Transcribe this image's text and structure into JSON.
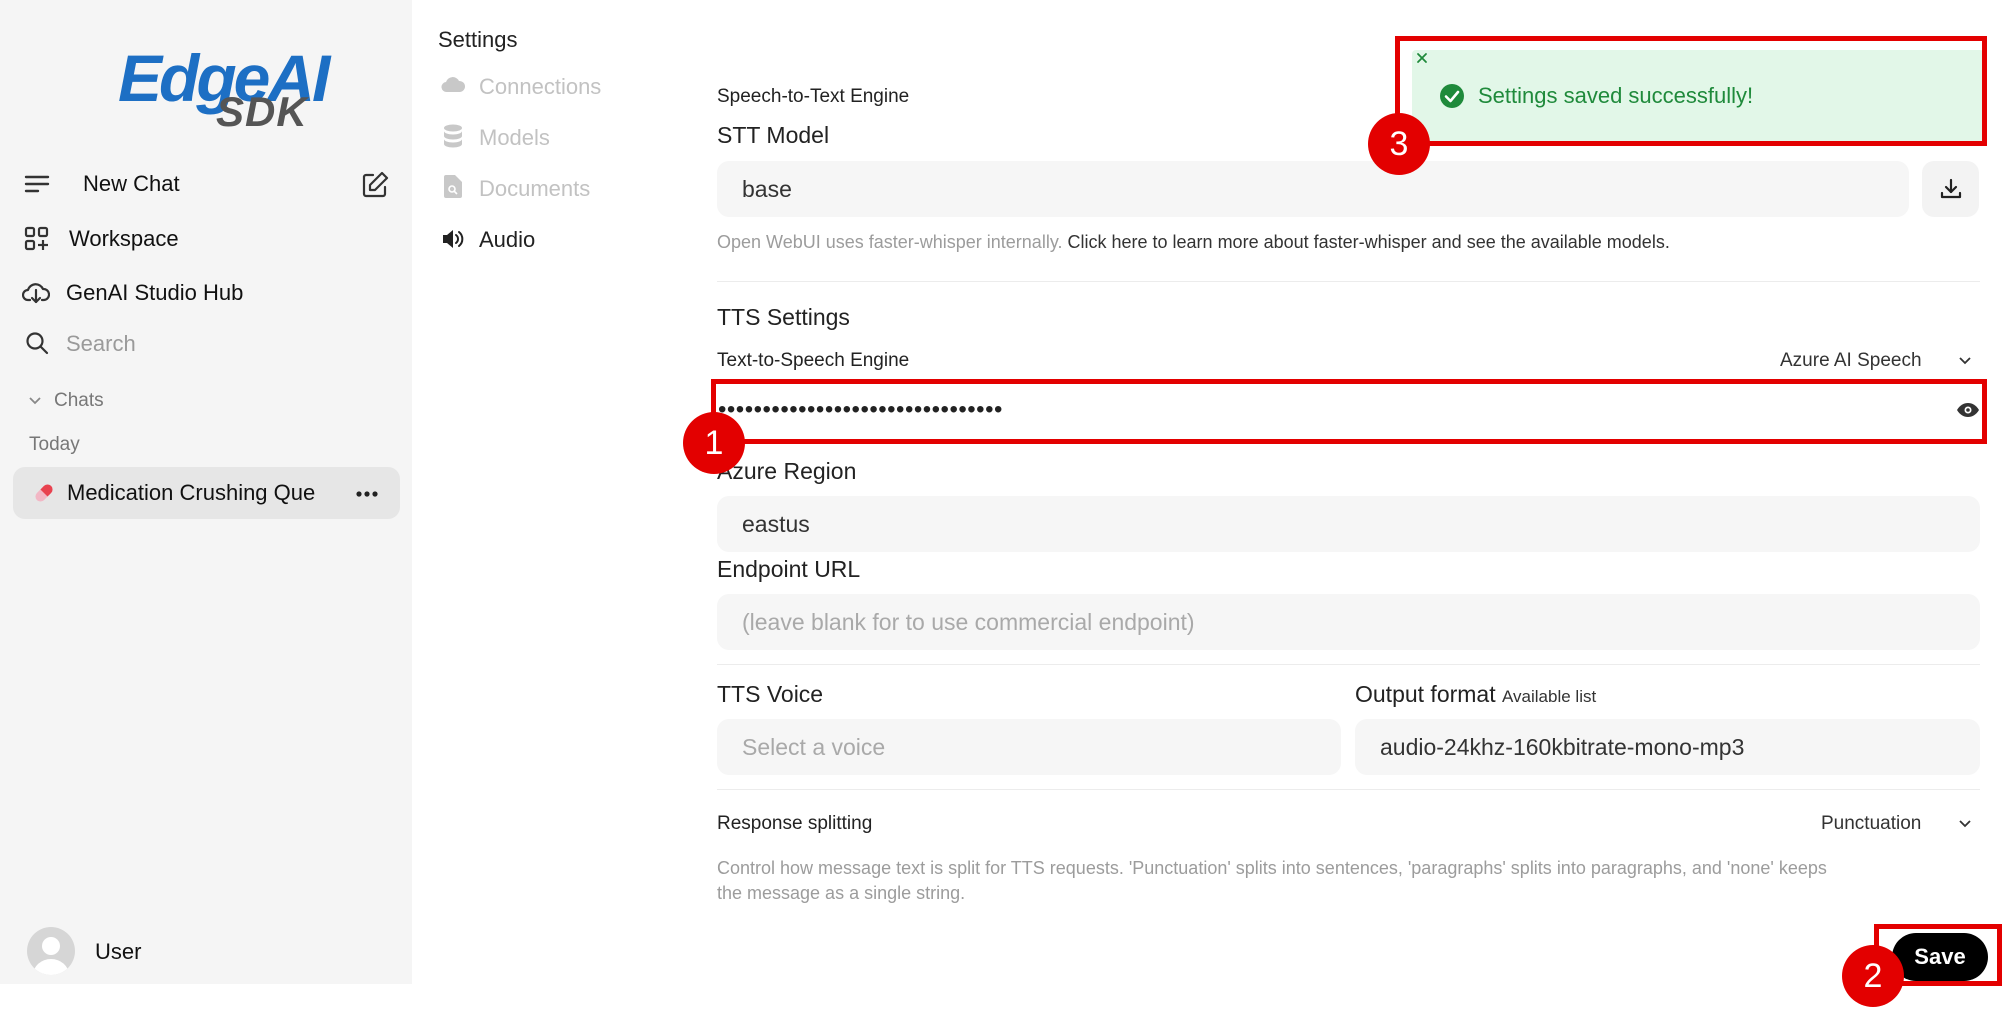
{
  "logo": {
    "line1": "EdgeAI",
    "line2": "SDK"
  },
  "sidebar": {
    "new_chat": "New Chat",
    "workspace": "Workspace",
    "hub": "GenAI Studio Hub",
    "search_placeholder": "Search",
    "chats_label": "Chats",
    "today_label": "Today",
    "chat_item": "Medication Crushing Que",
    "user_name": "User"
  },
  "settings_nav": {
    "title": "Settings",
    "items": [
      "Connections",
      "Models",
      "Documents",
      "Audio"
    ],
    "active": "Audio"
  },
  "stt": {
    "engine_label": "Speech-to-Text Engine",
    "model_label": "STT Model",
    "model_value": "base",
    "help_muted": "Open WebUI uses faster-whisper internally.",
    "help_link": "Click here to learn more about faster-whisper and see the available models."
  },
  "tts": {
    "section_title": "TTS Settings",
    "engine_label": "Text-to-Speech Engine",
    "engine_value": "Azure AI Speech",
    "api_key_masked": "••••••••••••••••••••••••••••••••",
    "region_label": "Azure Region",
    "region_value": "eastus",
    "endpoint_label": "Endpoint URL",
    "endpoint_placeholder": "(leave blank for to use commercial endpoint)",
    "voice_label": "TTS Voice",
    "voice_placeholder": "Select a voice",
    "format_label": "Output format",
    "format_hint": "Available list",
    "format_value": "audio-24khz-160kbitrate-mono-mp3",
    "splitting_label": "Response splitting",
    "splitting_value": "Punctuation",
    "splitting_help_1": "Control how message text is split for TTS requests. 'Punctuation' splits into sentences, 'paragraphs' splits into paragraphs, and 'none' keeps",
    "splitting_help_2": "the message as a single string."
  },
  "save_label": "Save",
  "toast": {
    "message": "Settings saved successfully!"
  },
  "annotations": {
    "badge_1": "1",
    "badge_2": "2",
    "badge_3": "3"
  },
  "colors": {
    "accent_red": "#e30000",
    "toast_green": "#1f8a3b",
    "logo_blue": "#1d6fc4"
  }
}
